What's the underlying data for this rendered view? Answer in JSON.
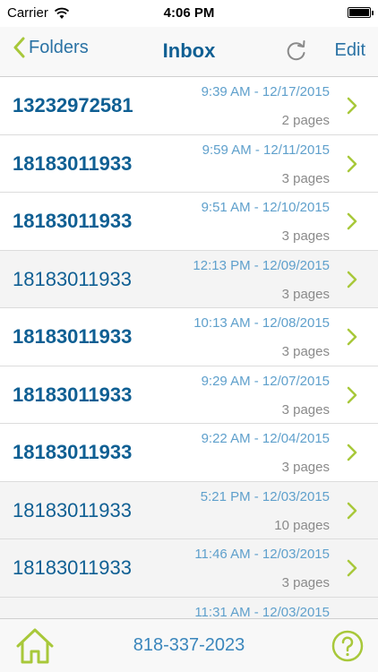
{
  "status_bar": {
    "carrier": "Carrier",
    "time": "4:06 PM"
  },
  "nav": {
    "back_label": "Folders",
    "title": "Inbox",
    "edit_label": "Edit"
  },
  "messages": [
    {
      "number": "13232972581",
      "date": "9:39 AM - 12/17/2015",
      "pages": "2 pages",
      "unread": true
    },
    {
      "number": "18183011933",
      "date": "9:59 AM - 12/11/2015",
      "pages": "3 pages",
      "unread": true
    },
    {
      "number": "18183011933",
      "date": "9:51 AM - 12/10/2015",
      "pages": "3 pages",
      "unread": true
    },
    {
      "number": "18183011933",
      "date": "12:13 PM - 12/09/2015",
      "pages": "3 pages",
      "unread": false
    },
    {
      "number": "18183011933",
      "date": "10:13 AM - 12/08/2015",
      "pages": "3 pages",
      "unread": true
    },
    {
      "number": "18183011933",
      "date": "9:29 AM - 12/07/2015",
      "pages": "3 pages",
      "unread": true
    },
    {
      "number": "18183011933",
      "date": "9:22 AM - 12/04/2015",
      "pages": "3 pages",
      "unread": true
    },
    {
      "number": "18183011933",
      "date": "5:21 PM - 12/03/2015",
      "pages": "10 pages",
      "unread": false
    },
    {
      "number": "18183011933",
      "date": "11:46 AM - 12/03/2015",
      "pages": "3 pages",
      "unread": false
    },
    {
      "number": "",
      "date": "11:31 AM - 12/03/2015",
      "pages": "",
      "unread": false
    }
  ],
  "tab_bar": {
    "phone_number": "818-337-2023"
  },
  "colors": {
    "accent_green": "#a8c83a",
    "title_blue": "#0f5f93",
    "date_blue": "#5fa0cc"
  }
}
